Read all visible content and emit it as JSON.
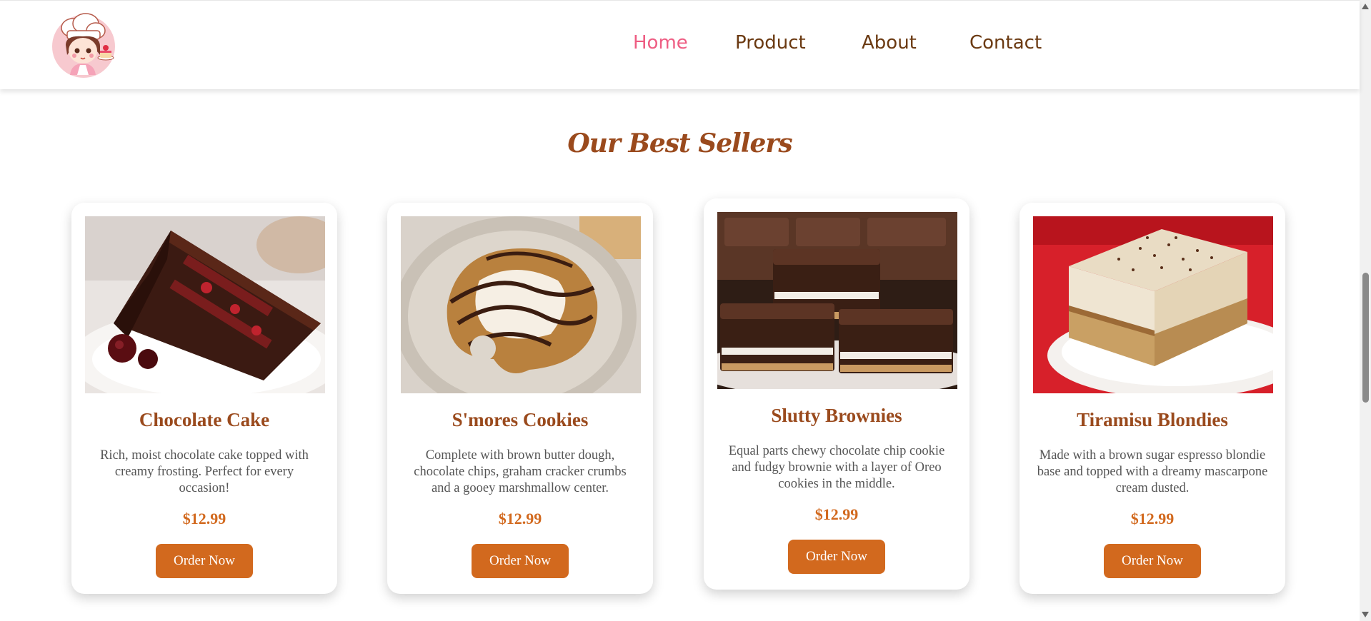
{
  "header": {
    "logo_alt": "Chef girl with cake logo",
    "nav": [
      {
        "label": "Home",
        "active": true
      },
      {
        "label": "Product",
        "active": false
      },
      {
        "label": "About",
        "active": false
      },
      {
        "label": "Contact",
        "active": false
      }
    ]
  },
  "section": {
    "title": "Our Best Sellers"
  },
  "products": [
    {
      "name": "Chocolate Cake",
      "description": "Rich, moist chocolate cake topped with creamy frosting. Perfect for every occasion!",
      "price": "$12.99",
      "button": "Order Now",
      "image": "chocolate-cake-photo"
    },
    {
      "name": "S'mores Cookies",
      "description": "Complete with brown butter dough, chocolate chips, graham cracker crumbs and a gooey marshmallow center.",
      "price": "$12.99",
      "button": "Order Now",
      "image": "smores-cookie-photo"
    },
    {
      "name": "Slutty Brownies",
      "description": "Equal parts chewy chocolate chip cookie and fudgy brownie with a layer of Oreo cookies in the middle.",
      "price": "$12.99",
      "button": "Order Now",
      "image": "brownies-photo"
    },
    {
      "name": "Tiramisu Blondies",
      "description": "Made with a brown sugar espresso blondie base and topped with a dreamy mascarpone cream dusted.",
      "price": "$12.99",
      "button": "Order Now",
      "image": "tiramisu-blondie-photo"
    }
  ],
  "colors": {
    "brand_brown": "#9a4a1d",
    "nav_text": "#6b3a12",
    "nav_active": "#ee5d83",
    "accent_orange": "#d2691e"
  }
}
